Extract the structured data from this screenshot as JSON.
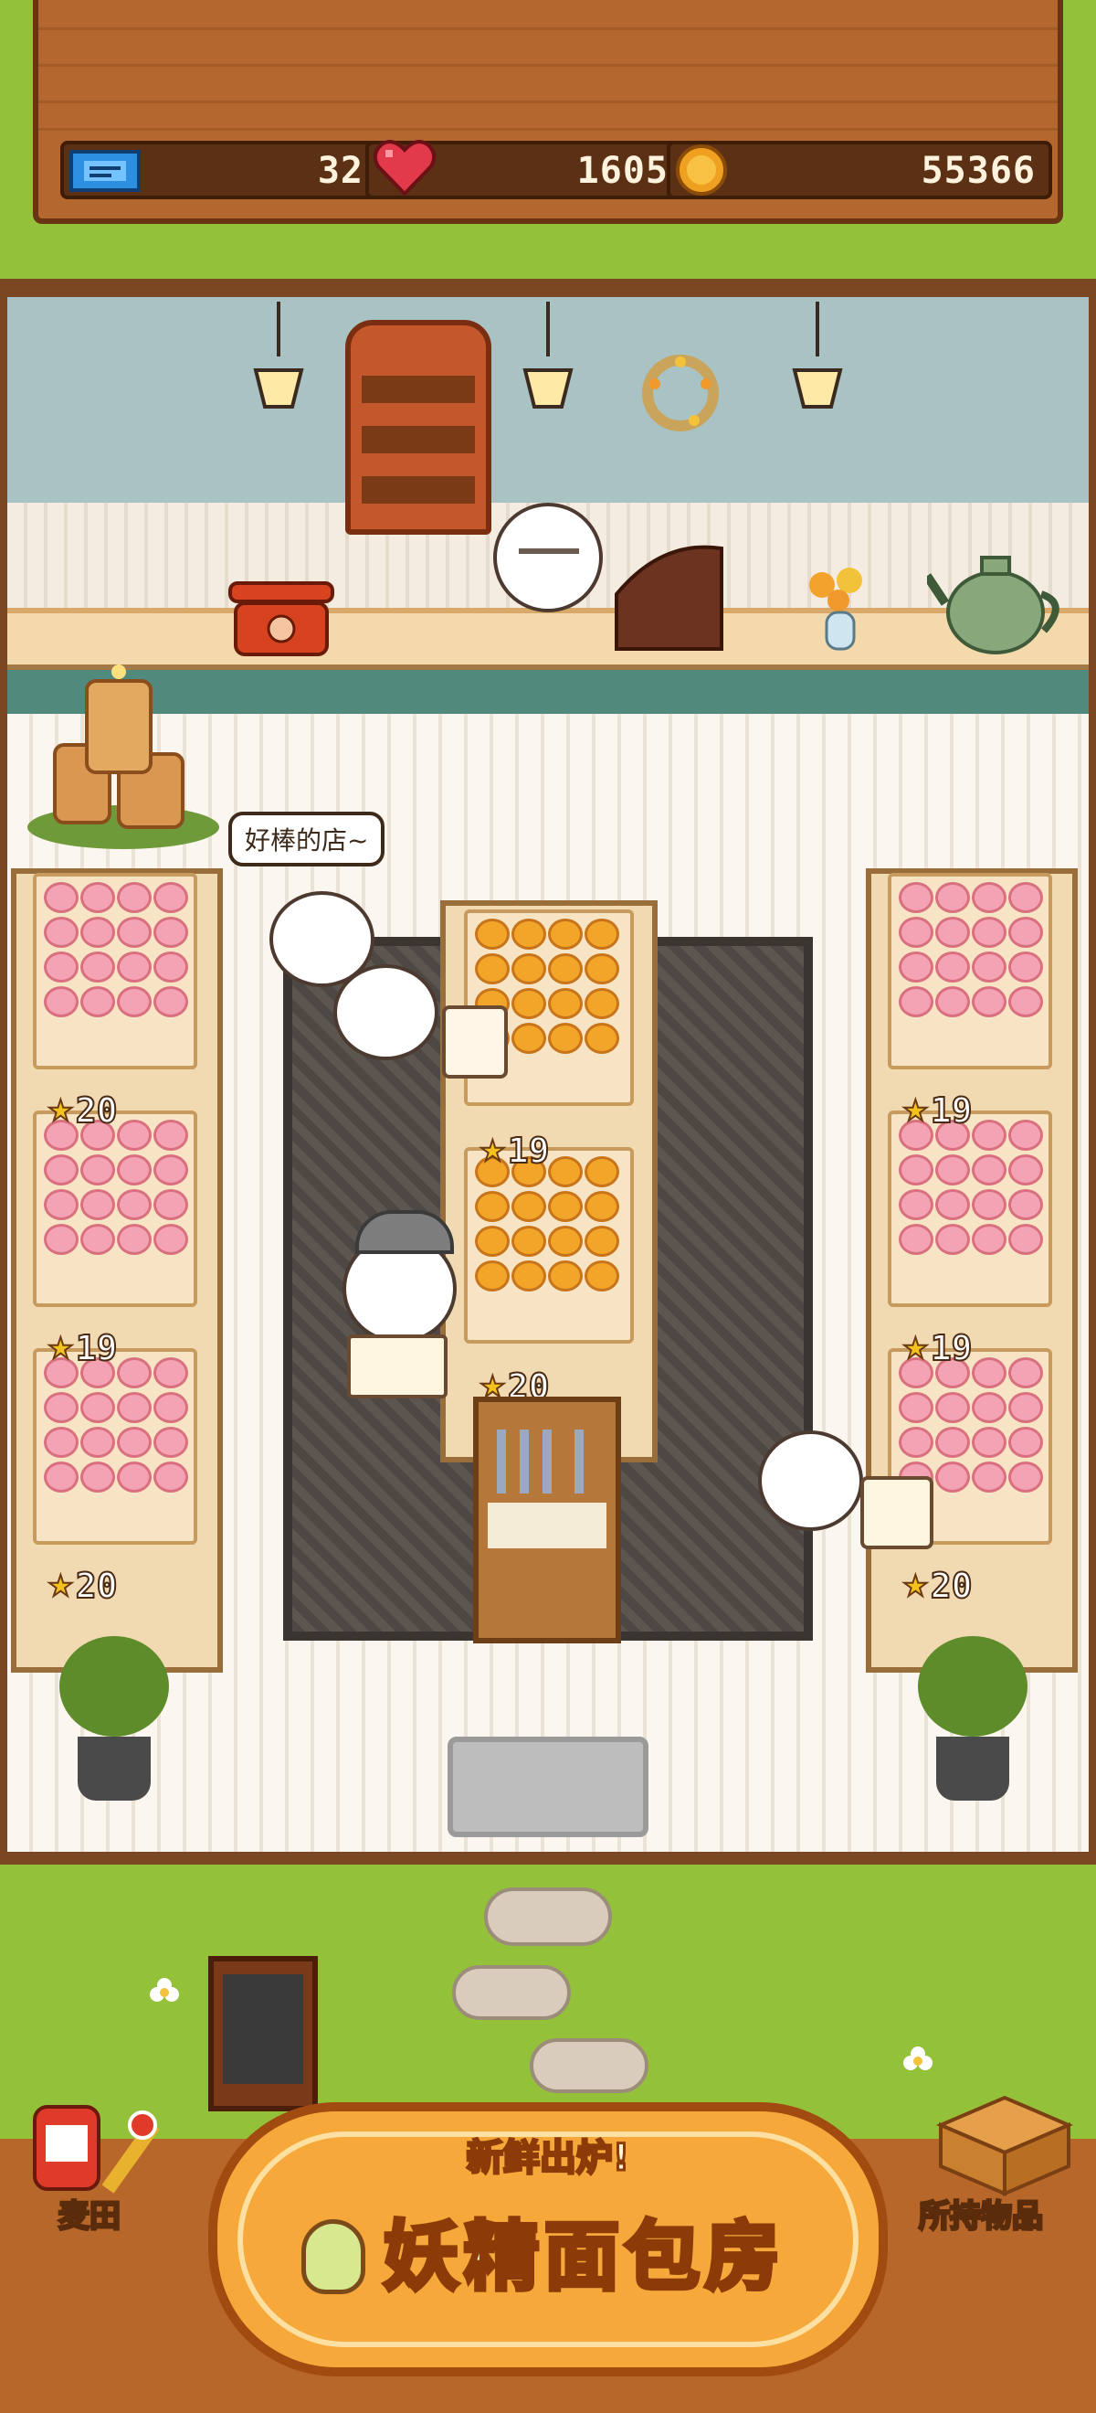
{
  "hud": {
    "tickets": "32",
    "hearts": "1605",
    "coins": "55366"
  },
  "shop": {
    "speech_bubble": "好棒的店~",
    "shelves": {
      "left": [
        "20",
        "19",
        "20"
      ],
      "center": [
        "19",
        "20"
      ],
      "right": [
        "19",
        "19",
        "20"
      ]
    }
  },
  "bottom_bar": {
    "left_button": "麦田",
    "right_button": "所持物品"
  },
  "logo": {
    "subtitle": "新鲜出炉!",
    "title": "妖精面包房"
  },
  "colors": {
    "grass": "#93c23a",
    "wood": "#b4672f",
    "star": "#f4c21d",
    "heart": "#e23a4a",
    "coin": "#f0a020",
    "ticket": "#2d8fe0"
  }
}
